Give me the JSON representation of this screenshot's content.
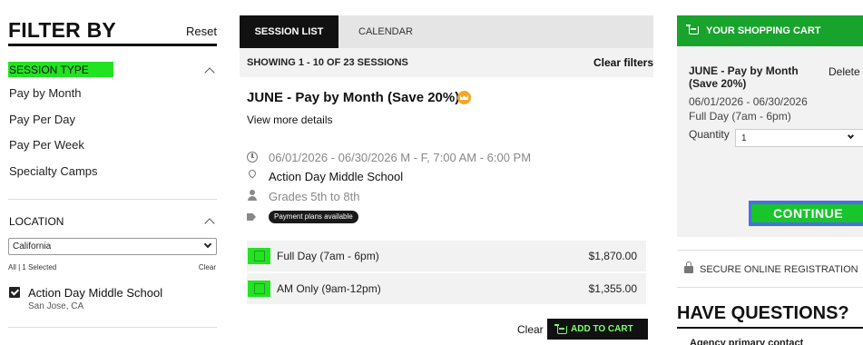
{
  "filter": {
    "title": "FILTER BY",
    "reset": "Reset",
    "session_type": {
      "label": "SESSION TYPE",
      "options": [
        "Pay by Month",
        "Pay Per Day",
        "Pay Per Week",
        "Specialty Camps"
      ]
    },
    "location": {
      "label": "LOCATION",
      "select_value": "California",
      "all_link": "All | 1 Selected",
      "clear_link": "Clear",
      "selected": {
        "name": "Action Day Middle School",
        "city": "San Jose, CA",
        "checked": true
      }
    }
  },
  "tabs": {
    "session_list": "SESSION LIST",
    "calendar": "CALENDAR"
  },
  "results": {
    "showing": "SHOWING 1 - 10 OF 23 SESSIONS",
    "clear_filters": "Clear filters"
  },
  "session": {
    "title": "JUNE - Pay by Month (Save 20%)",
    "view_more": "View more details",
    "dates": "06/01/2026 - 06/30/2026   M - F, 7:00 AM - 6:00 PM",
    "location": "Action Day Middle School",
    "grades": "Grades 5th to 8th",
    "badge": "Payment plans available",
    "options": [
      {
        "name": "Full Day (7am - 6pm)",
        "price": "$1,870.00"
      },
      {
        "name": "AM Only (9am-12pm)",
        "price": "$1,355.00"
      }
    ],
    "clear": "Clear",
    "add_to_cart": "ADD TO CART"
  },
  "cart": {
    "header": "YOUR SHOPPING CART",
    "item_name": "JUNE - Pay by Month (Save 20%)",
    "delete": "Delete",
    "dates": "06/01/2026 - 06/30/2026",
    "time": "Full Day (7am - 6pm)",
    "quantity_label": "Quantity",
    "quantity_value": "1",
    "continue": "CONTINUE"
  },
  "secure": "SECURE ONLINE REGISTRATION",
  "questions": {
    "title": "HAVE QUESTIONS?",
    "contact": "Agency primary contact"
  },
  "colors": {
    "highlight_green": "#22e321",
    "cart_header_green": "#18a32d",
    "continue_green": "#18c52b",
    "continue_highlight_blue": "#4a6fe0",
    "crown_orange": "#f5a623"
  }
}
